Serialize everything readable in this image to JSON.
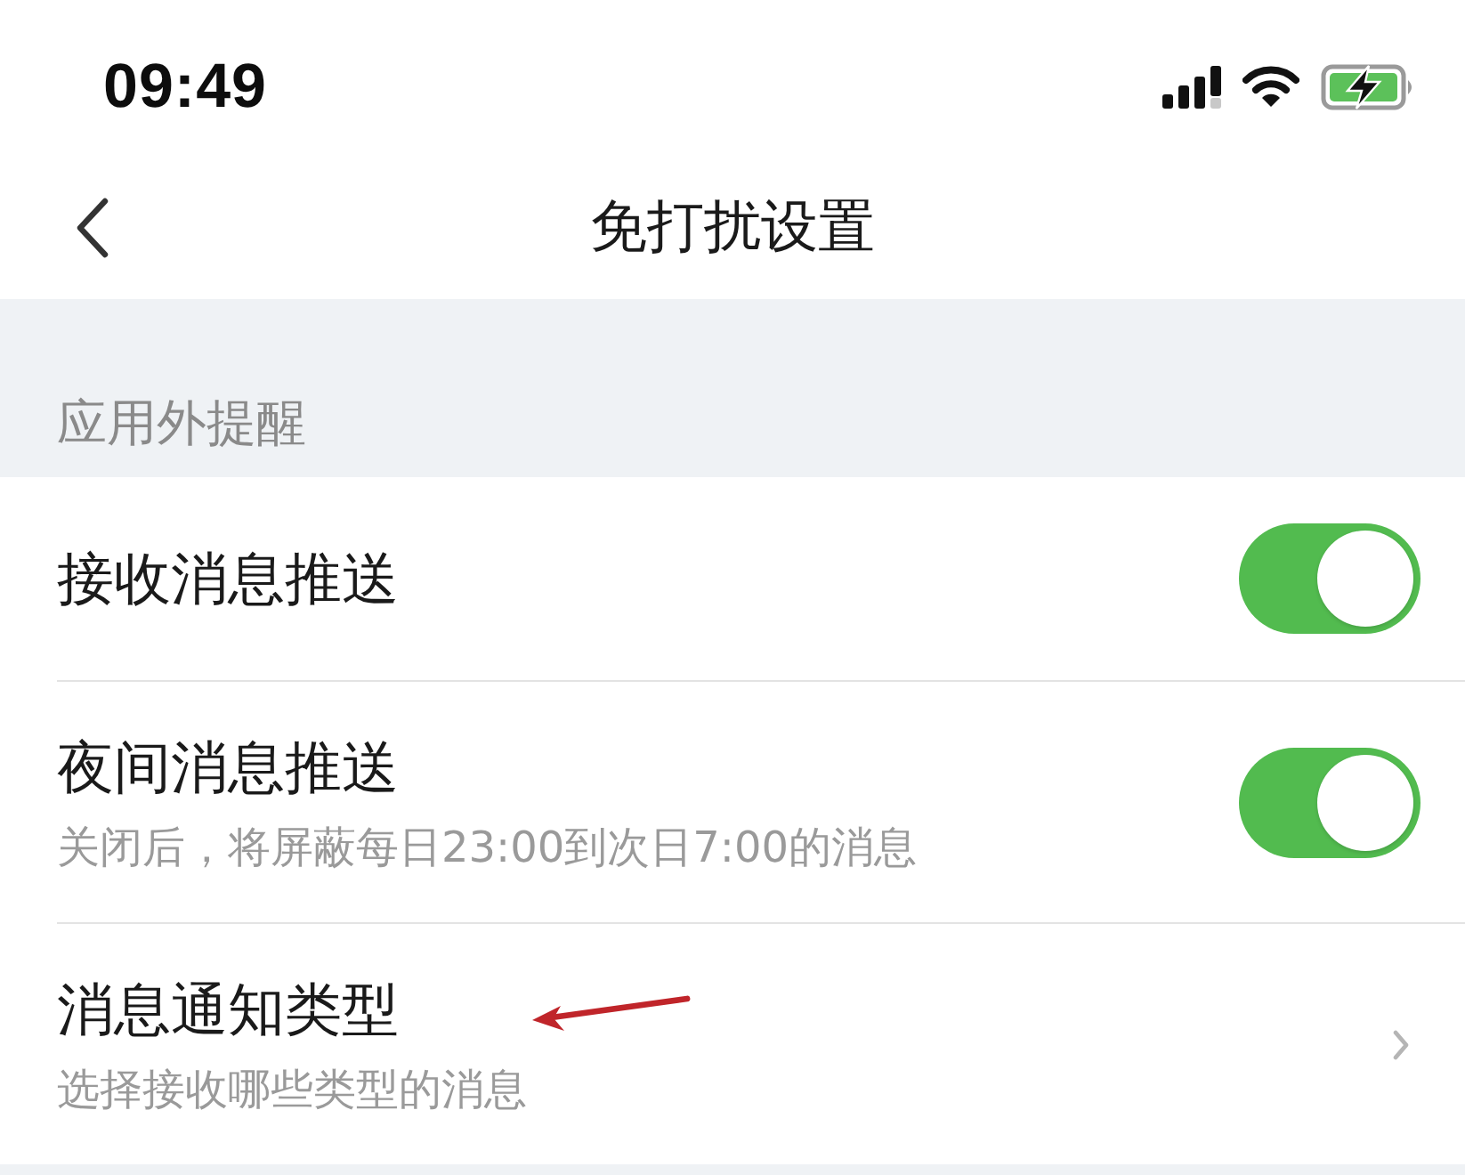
{
  "status_bar": {
    "time": "09:49"
  },
  "nav_bar": {
    "title": "免打扰设置"
  },
  "sections": [
    {
      "header": "应用外提醒",
      "rows": [
        {
          "kind": "switch",
          "title": "接收消息推送",
          "on": true,
          "annotated": false
        },
        {
          "kind": "switch",
          "title": "夜间消息推送",
          "subtitle": "关闭后，将屏蔽每日23:00到次日7:00的消息",
          "on": true,
          "annotated": false
        },
        {
          "kind": "link",
          "title": "消息通知类型",
          "subtitle": "选择接收哪些类型的消息",
          "annotated": true
        }
      ]
    }
  ]
}
